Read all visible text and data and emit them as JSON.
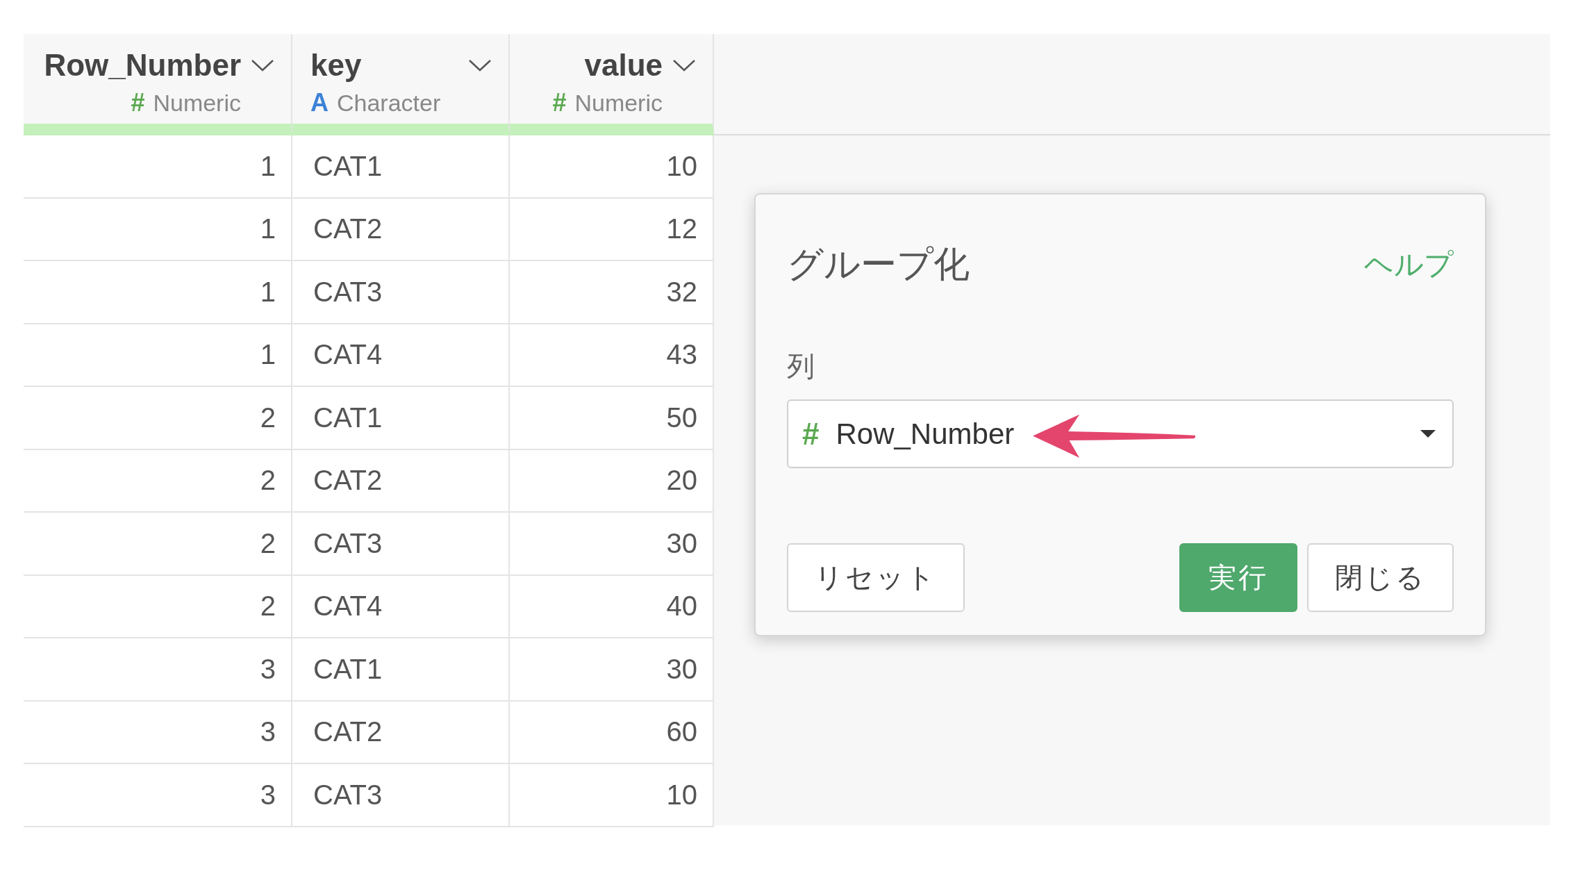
{
  "table": {
    "columns": [
      {
        "name": "Row_Number",
        "type": "Numeric",
        "type_icon": "#",
        "kind": "numeric"
      },
      {
        "name": "key",
        "type": "Character",
        "type_icon": "A",
        "kind": "character"
      },
      {
        "name": "value",
        "type": "Numeric",
        "type_icon": "#",
        "kind": "numeric"
      }
    ],
    "rows": [
      [
        "1",
        "CAT1",
        "10"
      ],
      [
        "1",
        "CAT2",
        "12"
      ],
      [
        "1",
        "CAT3",
        "32"
      ],
      [
        "1",
        "CAT4",
        "43"
      ],
      [
        "2",
        "CAT1",
        "50"
      ],
      [
        "2",
        "CAT2",
        "20"
      ],
      [
        "2",
        "CAT3",
        "30"
      ],
      [
        "2",
        "CAT4",
        "40"
      ],
      [
        "3",
        "CAT1",
        "30"
      ],
      [
        "3",
        "CAT2",
        "60"
      ],
      [
        "3",
        "CAT3",
        "10"
      ]
    ]
  },
  "dialog": {
    "title": "グループ化",
    "help": "ヘルプ",
    "field_label": "列",
    "select": {
      "type_icon": "#",
      "kind": "numeric",
      "value": "Row_Number"
    },
    "buttons": [
      {
        "label": "リセット",
        "kind": "default"
      },
      {
        "label": "実行",
        "kind": "primary"
      },
      {
        "label": "閉じる",
        "kind": "default"
      }
    ]
  }
}
